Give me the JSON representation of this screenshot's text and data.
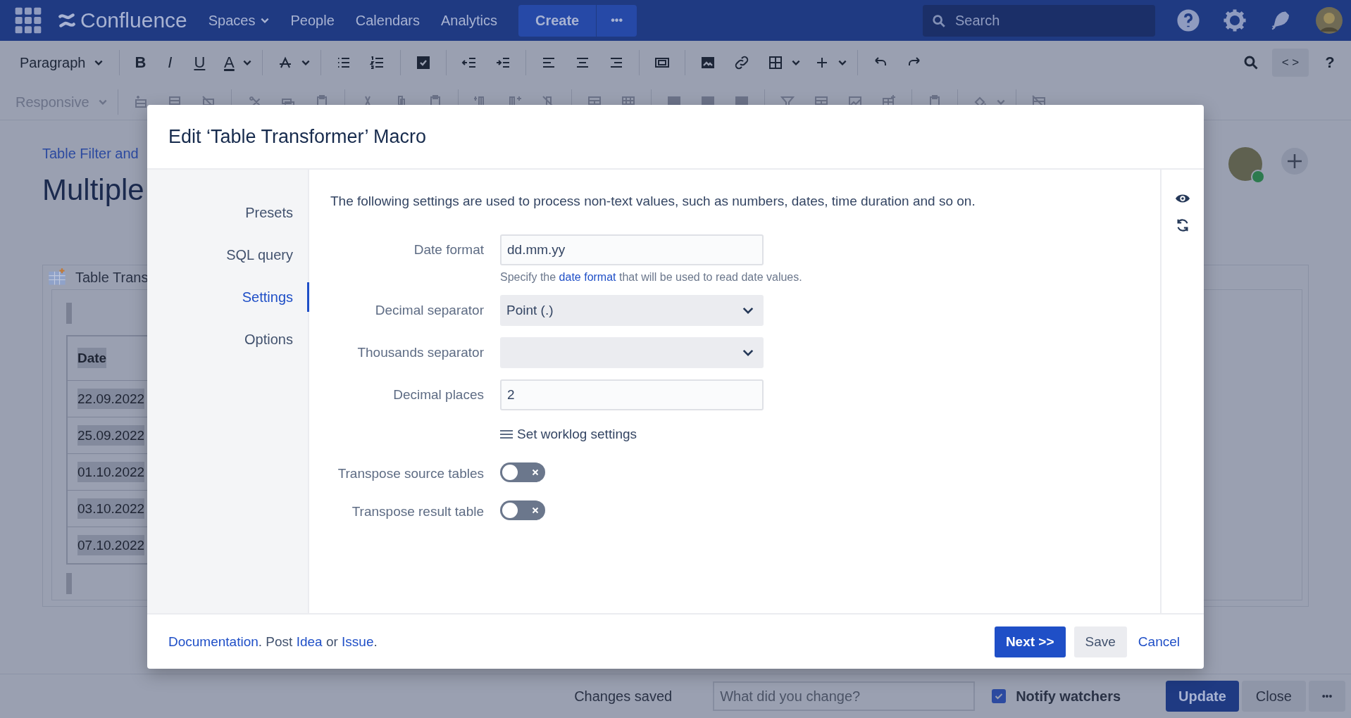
{
  "top_nav": {
    "logo": "Confluence",
    "menu": [
      {
        "label": "Spaces",
        "dropdown": true
      },
      {
        "label": "People",
        "dropdown": false
      },
      {
        "label": "Calendars",
        "dropdown": false
      },
      {
        "label": "Analytics",
        "dropdown": false
      }
    ],
    "create": "Create",
    "more": "•••",
    "search": {
      "placeholder": "Search"
    }
  },
  "toolbar": {
    "paragraph": "Paragraph",
    "format_buttons": [
      "B",
      "I",
      "U"
    ],
    "text_color": "A",
    "responsive": "Responsive",
    "source_button": "< >",
    "help": "?"
  },
  "page": {
    "breadcrumb": "Table Filter and",
    "title": "Multiple",
    "macro_title": "Table Trans",
    "table": {
      "header": "Date",
      "rows": [
        "22.09.2022",
        "25.09.2022",
        "01.10.2022",
        "03.10.2022",
        "07.10.2022"
      ]
    }
  },
  "dialog": {
    "title": "Edit ‘Table Transformer’ Macro",
    "nav": [
      {
        "label": "Presets",
        "selected": false
      },
      {
        "label": "SQL query",
        "selected": false
      },
      {
        "label": "Settings",
        "selected": true
      },
      {
        "label": "Options",
        "selected": false
      }
    ],
    "description": "The following settings are used to process non-text values, such as numbers, dates, time duration and so on.",
    "fields": [
      {
        "kind": "text",
        "label": "Date format",
        "value": "dd.mm.yy",
        "help": {
          "before": "Specify the ",
          "link": "date format",
          "after": " that will be used to read date values."
        }
      },
      {
        "kind": "select",
        "label": "Decimal separator",
        "value": "Point (.)"
      },
      {
        "kind": "select",
        "label": "Thousands separator"
      },
      {
        "kind": "text",
        "label": "Decimal places",
        "value": "2"
      },
      {
        "kind": "action",
        "label": "Set worklog settings"
      },
      {
        "kind": "toggle",
        "label": "Transpose source tables",
        "on": false
      },
      {
        "kind": "toggle",
        "label": "Transpose result table",
        "on": false
      }
    ],
    "footer_text": {
      "doc_link": "Documentation",
      "text_1": ". Post ",
      "idea_link": "Idea",
      "text_2": " or ",
      "issue_link": "Issue",
      "text_3": "."
    },
    "buttons": [
      {
        "kind": "primary",
        "label": "Next >>"
      },
      {
        "kind": "secondary",
        "label": "Save"
      },
      {
        "kind": "link",
        "label": "Cancel"
      }
    ]
  },
  "bottom_bar": {
    "status": "Changes saved",
    "comment": {
      "placeholder": "What did you change?"
    },
    "notify": {
      "label": "Notify watchers",
      "checked": true
    },
    "update": "Update",
    "close": "Close",
    "more": "•••"
  }
}
